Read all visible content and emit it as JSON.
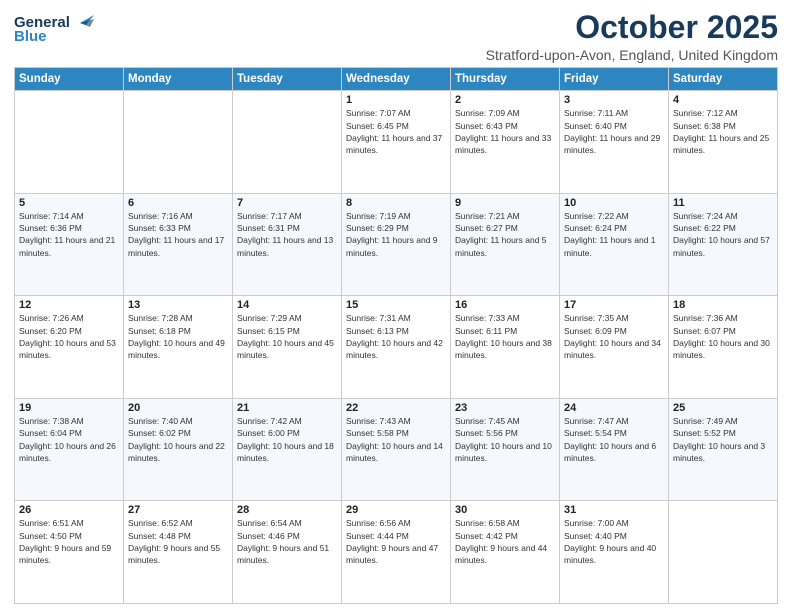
{
  "header": {
    "logo_general": "General",
    "logo_blue": "Blue",
    "month_title": "October 2025",
    "location": "Stratford-upon-Avon, England, United Kingdom"
  },
  "weekdays": [
    "Sunday",
    "Monday",
    "Tuesday",
    "Wednesday",
    "Thursday",
    "Friday",
    "Saturday"
  ],
  "weeks": [
    [
      {
        "day": "",
        "sunrise": "",
        "sunset": "",
        "daylight": ""
      },
      {
        "day": "",
        "sunrise": "",
        "sunset": "",
        "daylight": ""
      },
      {
        "day": "",
        "sunrise": "",
        "sunset": "",
        "daylight": ""
      },
      {
        "day": "1",
        "sunrise": "Sunrise: 7:07 AM",
        "sunset": "Sunset: 6:45 PM",
        "daylight": "Daylight: 11 hours and 37 minutes."
      },
      {
        "day": "2",
        "sunrise": "Sunrise: 7:09 AM",
        "sunset": "Sunset: 6:43 PM",
        "daylight": "Daylight: 11 hours and 33 minutes."
      },
      {
        "day": "3",
        "sunrise": "Sunrise: 7:11 AM",
        "sunset": "Sunset: 6:40 PM",
        "daylight": "Daylight: 11 hours and 29 minutes."
      },
      {
        "day": "4",
        "sunrise": "Sunrise: 7:12 AM",
        "sunset": "Sunset: 6:38 PM",
        "daylight": "Daylight: 11 hours and 25 minutes."
      }
    ],
    [
      {
        "day": "5",
        "sunrise": "Sunrise: 7:14 AM",
        "sunset": "Sunset: 6:36 PM",
        "daylight": "Daylight: 11 hours and 21 minutes."
      },
      {
        "day": "6",
        "sunrise": "Sunrise: 7:16 AM",
        "sunset": "Sunset: 6:33 PM",
        "daylight": "Daylight: 11 hours and 17 minutes."
      },
      {
        "day": "7",
        "sunrise": "Sunrise: 7:17 AM",
        "sunset": "Sunset: 6:31 PM",
        "daylight": "Daylight: 11 hours and 13 minutes."
      },
      {
        "day": "8",
        "sunrise": "Sunrise: 7:19 AM",
        "sunset": "Sunset: 6:29 PM",
        "daylight": "Daylight: 11 hours and 9 minutes."
      },
      {
        "day": "9",
        "sunrise": "Sunrise: 7:21 AM",
        "sunset": "Sunset: 6:27 PM",
        "daylight": "Daylight: 11 hours and 5 minutes."
      },
      {
        "day": "10",
        "sunrise": "Sunrise: 7:22 AM",
        "sunset": "Sunset: 6:24 PM",
        "daylight": "Daylight: 11 hours and 1 minute."
      },
      {
        "day": "11",
        "sunrise": "Sunrise: 7:24 AM",
        "sunset": "Sunset: 6:22 PM",
        "daylight": "Daylight: 10 hours and 57 minutes."
      }
    ],
    [
      {
        "day": "12",
        "sunrise": "Sunrise: 7:26 AM",
        "sunset": "Sunset: 6:20 PM",
        "daylight": "Daylight: 10 hours and 53 minutes."
      },
      {
        "day": "13",
        "sunrise": "Sunrise: 7:28 AM",
        "sunset": "Sunset: 6:18 PM",
        "daylight": "Daylight: 10 hours and 49 minutes."
      },
      {
        "day": "14",
        "sunrise": "Sunrise: 7:29 AM",
        "sunset": "Sunset: 6:15 PM",
        "daylight": "Daylight: 10 hours and 45 minutes."
      },
      {
        "day": "15",
        "sunrise": "Sunrise: 7:31 AM",
        "sunset": "Sunset: 6:13 PM",
        "daylight": "Daylight: 10 hours and 42 minutes."
      },
      {
        "day": "16",
        "sunrise": "Sunrise: 7:33 AM",
        "sunset": "Sunset: 6:11 PM",
        "daylight": "Daylight: 10 hours and 38 minutes."
      },
      {
        "day": "17",
        "sunrise": "Sunrise: 7:35 AM",
        "sunset": "Sunset: 6:09 PM",
        "daylight": "Daylight: 10 hours and 34 minutes."
      },
      {
        "day": "18",
        "sunrise": "Sunrise: 7:36 AM",
        "sunset": "Sunset: 6:07 PM",
        "daylight": "Daylight: 10 hours and 30 minutes."
      }
    ],
    [
      {
        "day": "19",
        "sunrise": "Sunrise: 7:38 AM",
        "sunset": "Sunset: 6:04 PM",
        "daylight": "Daylight: 10 hours and 26 minutes."
      },
      {
        "day": "20",
        "sunrise": "Sunrise: 7:40 AM",
        "sunset": "Sunset: 6:02 PM",
        "daylight": "Daylight: 10 hours and 22 minutes."
      },
      {
        "day": "21",
        "sunrise": "Sunrise: 7:42 AM",
        "sunset": "Sunset: 6:00 PM",
        "daylight": "Daylight: 10 hours and 18 minutes."
      },
      {
        "day": "22",
        "sunrise": "Sunrise: 7:43 AM",
        "sunset": "Sunset: 5:58 PM",
        "daylight": "Daylight: 10 hours and 14 minutes."
      },
      {
        "day": "23",
        "sunrise": "Sunrise: 7:45 AM",
        "sunset": "Sunset: 5:56 PM",
        "daylight": "Daylight: 10 hours and 10 minutes."
      },
      {
        "day": "24",
        "sunrise": "Sunrise: 7:47 AM",
        "sunset": "Sunset: 5:54 PM",
        "daylight": "Daylight: 10 hours and 6 minutes."
      },
      {
        "day": "25",
        "sunrise": "Sunrise: 7:49 AM",
        "sunset": "Sunset: 5:52 PM",
        "daylight": "Daylight: 10 hours and 3 minutes."
      }
    ],
    [
      {
        "day": "26",
        "sunrise": "Sunrise: 6:51 AM",
        "sunset": "Sunset: 4:50 PM",
        "daylight": "Daylight: 9 hours and 59 minutes."
      },
      {
        "day": "27",
        "sunrise": "Sunrise: 6:52 AM",
        "sunset": "Sunset: 4:48 PM",
        "daylight": "Daylight: 9 hours and 55 minutes."
      },
      {
        "day": "28",
        "sunrise": "Sunrise: 6:54 AM",
        "sunset": "Sunset: 4:46 PM",
        "daylight": "Daylight: 9 hours and 51 minutes."
      },
      {
        "day": "29",
        "sunrise": "Sunrise: 6:56 AM",
        "sunset": "Sunset: 4:44 PM",
        "daylight": "Daylight: 9 hours and 47 minutes."
      },
      {
        "day": "30",
        "sunrise": "Sunrise: 6:58 AM",
        "sunset": "Sunset: 4:42 PM",
        "daylight": "Daylight: 9 hours and 44 minutes."
      },
      {
        "day": "31",
        "sunrise": "Sunrise: 7:00 AM",
        "sunset": "Sunset: 4:40 PM",
        "daylight": "Daylight: 9 hours and 40 minutes."
      },
      {
        "day": "",
        "sunrise": "",
        "sunset": "",
        "daylight": ""
      }
    ]
  ]
}
